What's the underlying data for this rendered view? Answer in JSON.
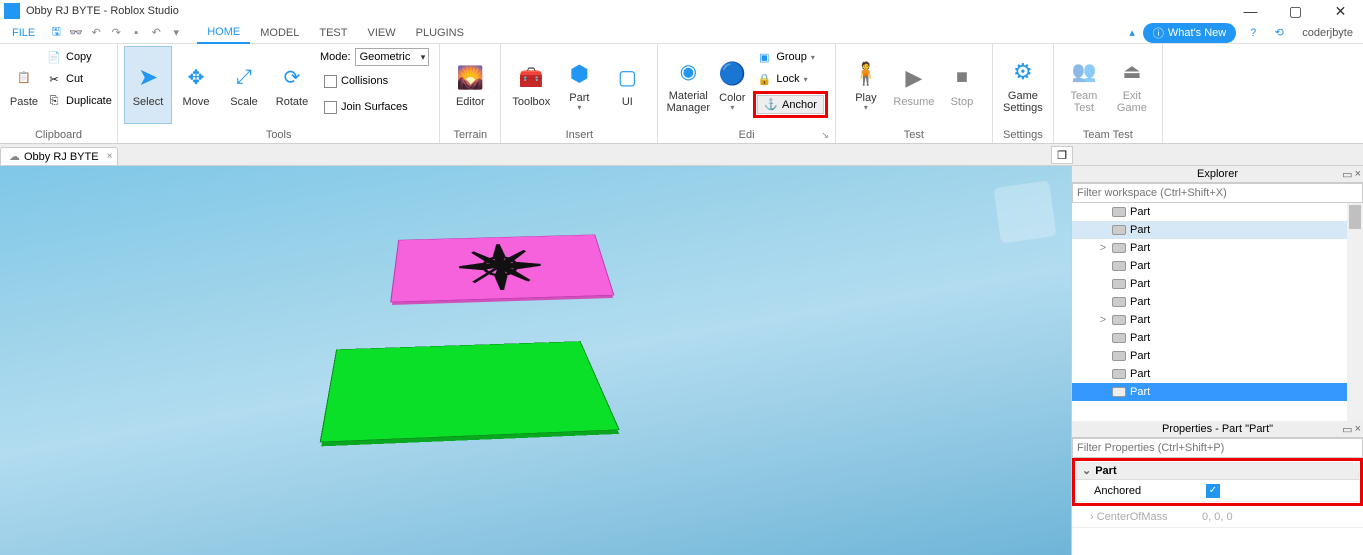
{
  "title": "Obby RJ BYTE - Roblox Studio",
  "menubar": {
    "file": "FILE",
    "tabs": [
      "HOME",
      "MODEL",
      "TEST",
      "VIEW",
      "PLUGINS"
    ],
    "active_tab": "HOME",
    "whats_new": "What's New",
    "username": "coderjbyte"
  },
  "ribbon": {
    "clipboard": {
      "paste": "Paste",
      "copy": "Copy",
      "cut": "Cut",
      "duplicate": "Duplicate",
      "group": "Clipboard"
    },
    "tools": {
      "select": "Select",
      "move": "Move",
      "scale": "Scale",
      "rotate": "Rotate",
      "mode_label": "Mode:",
      "mode_value": "Geometric",
      "collisions": "Collisions",
      "join": "Join Surfaces",
      "group": "Tools"
    },
    "terrain": {
      "editor": "Editor",
      "group": "Terrain"
    },
    "insert": {
      "toolbox": "Toolbox",
      "part": "Part",
      "ui": "UI",
      "group": "Insert"
    },
    "edit": {
      "material": "Material",
      "manager": "Manager",
      "color": "Color",
      "group_btn": "Group",
      "lock": "Lock",
      "anchor": "Anchor",
      "group": "Edi"
    },
    "test": {
      "play": "Play",
      "resume": "Resume",
      "stop": "Stop",
      "group": "Test"
    },
    "settings": {
      "game": "Game",
      "settings": "Settings",
      "group": "Settings"
    },
    "teamtest": {
      "team": "Team",
      "test": "Test",
      "exit": "Exit",
      "game": "Game",
      "group": "Team Test"
    }
  },
  "doc_tab": "Obby RJ BYTE",
  "explorer": {
    "title": "Explorer",
    "filter_placeholder": "Filter workspace (Ctrl+Shift+X)",
    "items": [
      {
        "label": "Part",
        "exp": "",
        "sel": false,
        "hi": false
      },
      {
        "label": "Part",
        "exp": "",
        "sel": false,
        "hi": true
      },
      {
        "label": "Part",
        "exp": ">",
        "sel": false,
        "hi": false
      },
      {
        "label": "Part",
        "exp": "",
        "sel": false,
        "hi": false
      },
      {
        "label": "Part",
        "exp": "",
        "sel": false,
        "hi": false
      },
      {
        "label": "Part",
        "exp": "",
        "sel": false,
        "hi": false
      },
      {
        "label": "Part",
        "exp": ">",
        "sel": false,
        "hi": false
      },
      {
        "label": "Part",
        "exp": "",
        "sel": false,
        "hi": false
      },
      {
        "label": "Part",
        "exp": "",
        "sel": false,
        "hi": false
      },
      {
        "label": "Part",
        "exp": "",
        "sel": false,
        "hi": false
      },
      {
        "label": "Part",
        "exp": "",
        "sel": true,
        "hi": false
      }
    ]
  },
  "properties": {
    "title": "Properties - Part \"Part\"",
    "filter_placeholder": "Filter Properties (Ctrl+Shift+P)",
    "section": "Part",
    "anchored_label": "Anchored",
    "anchored_value": true,
    "center_label": "CenterOfMass",
    "center_value": "0, 0, 0"
  }
}
